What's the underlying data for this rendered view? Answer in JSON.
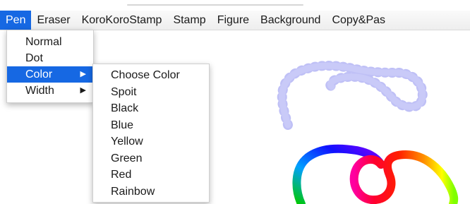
{
  "menubar": {
    "items": [
      {
        "label": "Pen"
      },
      {
        "label": "Eraser"
      },
      {
        "label": "KoroKoroStamp"
      },
      {
        "label": "Stamp"
      },
      {
        "label": "Figure"
      },
      {
        "label": "Background"
      },
      {
        "label": "Copy&Pas"
      }
    ],
    "active_index": 0
  },
  "pen_menu": {
    "items": [
      {
        "label": "Normal",
        "has_submenu": false
      },
      {
        "label": "Dot",
        "has_submenu": false
      },
      {
        "label": "Color",
        "has_submenu": true,
        "arrow": "▶"
      },
      {
        "label": "Width",
        "has_submenu": true,
        "arrow": "▶"
      }
    ],
    "highlighted_index": 2
  },
  "color_submenu": {
    "items": [
      {
        "label": "Choose Color"
      },
      {
        "label": "Spoit"
      },
      {
        "label": "Black"
      },
      {
        "label": "Blue"
      },
      {
        "label": "Yellow"
      },
      {
        "label": "Green"
      },
      {
        "label": "Red"
      },
      {
        "label": "Rainbow"
      }
    ]
  },
  "canvas": {
    "strokes": [
      {
        "name": "blue-dotted-loop-stroke",
        "color": "#8c8ef0"
      },
      {
        "name": "rainbow-stroke-left",
        "colors": [
          "#00c800",
          "#00a0ff",
          "#0000ff",
          "#8000ff"
        ]
      },
      {
        "name": "rainbow-stroke-right",
        "colors": [
          "#ff0080",
          "#ff0000",
          "#ff8000",
          "#ffff00",
          "#80ff00"
        ]
      }
    ]
  },
  "colors": {
    "menu_highlight": "#1668e3",
    "menu_text": "#1a1a1a"
  }
}
